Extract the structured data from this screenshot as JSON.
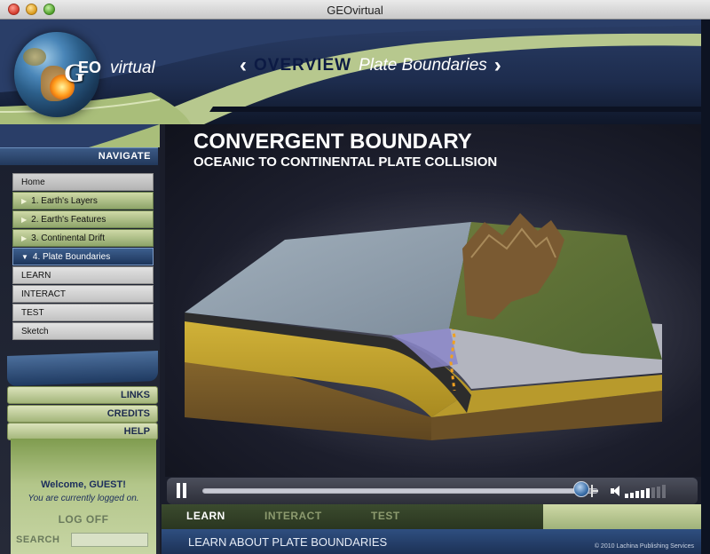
{
  "window": {
    "title": "GEOvirtual"
  },
  "logo": {
    "g": "G",
    "eo": "EO",
    "virtual": "virtual"
  },
  "header": {
    "prev_label": "‹",
    "overview": "OVERVIEW",
    "section": "Plate Boundaries",
    "next_label": "›"
  },
  "sidebar": {
    "navigate_label": "NAVIGATE",
    "items": [
      {
        "label": "Home",
        "kind": "home"
      },
      {
        "label": "1. Earth's Layers",
        "kind": "chapter"
      },
      {
        "label": "2. Earth's Features",
        "kind": "chapter"
      },
      {
        "label": "3. Continental Drift",
        "kind": "chapter"
      },
      {
        "label": "4. Plate Boundaries",
        "kind": "chapter-active"
      },
      {
        "label": "LEARN",
        "kind": "sub"
      },
      {
        "label": "INTERACT",
        "kind": "sub"
      },
      {
        "label": "TEST",
        "kind": "sub"
      },
      {
        "label": "Sketch",
        "kind": "sub"
      }
    ],
    "links": [
      "LINKS",
      "CREDITS",
      "HELP"
    ],
    "welcome": "Welcome, GUEST!",
    "logged_in": "You are currently logged on.",
    "logoff": "LOG OFF",
    "search_label": "SEARCH",
    "search_value": ""
  },
  "slide": {
    "title": "CONVERGENT BOUNDARY",
    "subtitle": "OCEANIC TO CONTINENTAL PLATE COLLISION"
  },
  "player": {
    "state": "playing",
    "progress_fraction": 0.97,
    "volume_level": 5,
    "volume_max": 8
  },
  "modes": {
    "tabs": [
      "LEARN",
      "INTERACT",
      "TEST"
    ],
    "active": "LEARN"
  },
  "footer": {
    "caption": "LEARN ABOUT PLATE BOUNDARIES",
    "copyright": "© 2010 Lachina Publishing Services"
  },
  "colors": {
    "header_navy": "#1d2c4d",
    "accent_green": "#b3c68a",
    "active_blue": "#1c345a"
  }
}
